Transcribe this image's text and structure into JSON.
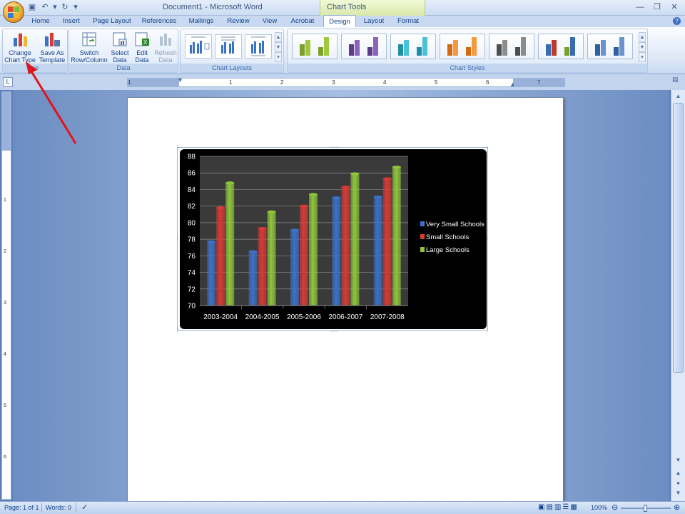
{
  "window": {
    "title": "Document1 - Microsoft Word",
    "context_tab_group": "Chart Tools"
  },
  "tabs": [
    {
      "label": "Home"
    },
    {
      "label": "Insert"
    },
    {
      "label": "Page Layout"
    },
    {
      "label": "References"
    },
    {
      "label": "Mailings"
    },
    {
      "label": "Review"
    },
    {
      "label": "View"
    },
    {
      "label": "Acrobat"
    },
    {
      "label": "Design"
    },
    {
      "label": "Layout"
    },
    {
      "label": "Format"
    }
  ],
  "active_tab": "Design",
  "ribbon": {
    "type_group": {
      "label": "Type",
      "visible_label": "pe",
      "change_chart_type_line1": "Change",
      "change_chart_type_line2": "Chart Type",
      "save_as_template_line1": "Save As",
      "save_as_template_line2": "Template"
    },
    "data_group": {
      "label": "Data",
      "switch_line1": "Switch",
      "switch_line2": "Row/Column",
      "select_line1": "Select",
      "select_line2": "Data",
      "edit_line1": "Edit",
      "edit_line2": "Data",
      "refresh_line1": "Refresh",
      "refresh_line2": "Data"
    },
    "chart_layouts_group": {
      "label": "Chart Layouts"
    },
    "chart_styles_group": {
      "label": "Chart Styles",
      "style_colors": [
        [
          "#7aa02a",
          "#a0c83e"
        ],
        [
          "#5e3a8c",
          "#8a64b8"
        ],
        [
          "#1f8fa6",
          "#4cc0d4"
        ],
        [
          "#d26b12",
          "#f59a3c"
        ],
        [
          "#4d4d4d",
          "#8c8c8c"
        ],
        [
          "#3a6ab0",
          "#c0392b",
          "#7aa02a"
        ],
        [
          "#2f5f9e",
          "#6b93cf"
        ]
      ]
    }
  },
  "ruler": {
    "numbers": [
      "1",
      "1",
      "2",
      "3",
      "4",
      "5",
      "6",
      "7"
    ],
    "vertical_numbers": [
      "1",
      "2",
      "3",
      "4",
      "5",
      "6"
    ]
  },
  "status": {
    "page": "Page: 1 of 1",
    "words": "Words: 0",
    "zoom": "100%"
  },
  "chart_data": {
    "type": "bar",
    "categories": [
      "2003-2004",
      "2004-2005",
      "2005-2006",
      "2006-2007",
      "2007-2008"
    ],
    "series": [
      {
        "name": "Very Small Schools",
        "color": "#3a72c8",
        "values": [
          77.7,
          76.5,
          79.1,
          83.0,
          83.1
        ]
      },
      {
        "name": "Small Schools",
        "color": "#d83a35",
        "values": [
          81.8,
          79.3,
          82.0,
          84.3,
          85.3
        ]
      },
      {
        "name": "Large Schools",
        "color": "#8fc63a",
        "values": [
          84.8,
          81.3,
          83.4,
          85.9,
          86.7
        ]
      }
    ],
    "ylim": [
      70,
      88
    ],
    "yticks": [
      "70",
      "72",
      "74",
      "76",
      "78",
      "80",
      "82",
      "84",
      "86",
      "88"
    ],
    "title": "",
    "xlabel": "",
    "ylabel": "",
    "legend_position": "right",
    "background": "#000000",
    "plot_background": "#3a3a3a",
    "grid": true
  }
}
